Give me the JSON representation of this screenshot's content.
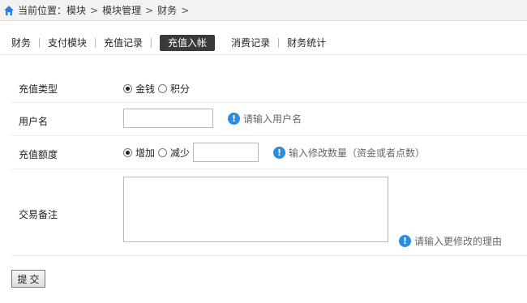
{
  "breadcrumb": {
    "label": "当前位置：",
    "items": [
      "模块",
      "模块管理",
      "财务"
    ],
    "separator": ">"
  },
  "tabs": [
    {
      "label": "财务"
    },
    {
      "label": "支付模块"
    },
    {
      "label": "充值记录"
    },
    {
      "label": "充值入帐",
      "active": true
    },
    {
      "label": "消费记录"
    },
    {
      "label": "财务统计"
    }
  ],
  "form": {
    "type": {
      "label": "充值类型",
      "options": [
        {
          "label": "金钱",
          "checked": true
        },
        {
          "label": "积分",
          "checked": false
        }
      ]
    },
    "username": {
      "label": "用户名",
      "value": "",
      "hint": "请输入用户名"
    },
    "amount": {
      "label": "充值额度",
      "options": [
        {
          "label": "增加",
          "checked": true
        },
        {
          "label": "减少",
          "checked": false
        }
      ],
      "value": "",
      "hint": "输入修改数量（资金或者点数）"
    },
    "note": {
      "label": "交易备注",
      "value": "",
      "hint": "请输入更修改的理由"
    },
    "submit_label": "提交"
  },
  "colors": {
    "active_tab_bg": "#3a3a3a",
    "info_icon": "#2b8de0",
    "home_icon": "#2b7fd6"
  },
  "icons": {
    "home": "home-icon",
    "info": "info-icon"
  }
}
